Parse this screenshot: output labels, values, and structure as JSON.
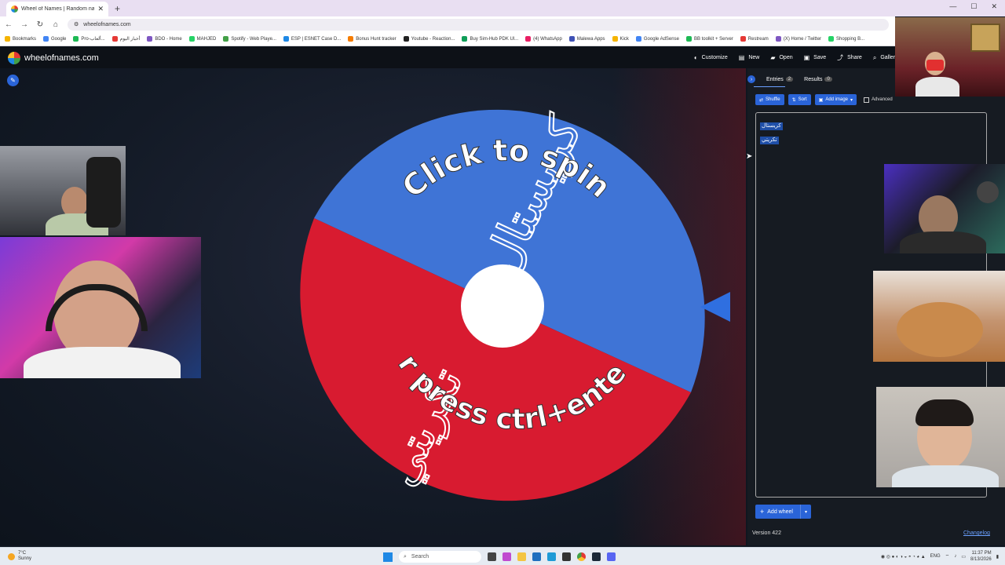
{
  "browser": {
    "tab_title": "Wheel of Names | Random nam",
    "url": "wheelofnames.com",
    "bookmarks": [
      "Bookmarks",
      "Google",
      "Pro-ألعاب...",
      "أخبار اليوم",
      "BDO - Home",
      "MAHJED",
      "Spotify - Web Playe...",
      "ESP | ESNET Case D...",
      "Bonus Hunt tracker",
      "Youtube - Reaction...",
      "Buy Sim-Hub PDK Ul...",
      "(4) WhatsApp",
      "Malewa Apps",
      "Kick",
      "Google AdSense",
      "BB toolkit + Server",
      "Restream",
      "(X) Home / Twitter",
      "Shopping B..."
    ]
  },
  "header": {
    "brand": "wheelofnames.com",
    "buttons": [
      {
        "label": "Customize",
        "icon": "palette-icon"
      },
      {
        "label": "New",
        "icon": "file-icon"
      },
      {
        "label": "Open",
        "icon": "folder-icon"
      },
      {
        "label": "Save",
        "icon": "save-icon"
      },
      {
        "label": "Share",
        "icon": "share-icon"
      },
      {
        "label": "Galler",
        "icon": "search-icon"
      }
    ]
  },
  "wheel": {
    "click_text": "Click to spin",
    "press_text": "or press ctrl+enter",
    "segments": [
      {
        "label": "كريستال",
        "color": "#3f74d6"
      },
      {
        "label": "تكريتي",
        "color": "#d81b30"
      }
    ],
    "pointer_color": "#2f6fe0"
  },
  "panel": {
    "tabs": [
      {
        "label": "Entries",
        "count": "2"
      },
      {
        "label": "Results",
        "count": "0"
      }
    ],
    "buttons": {
      "shuffle": "Shuffle",
      "sort": "Sort",
      "add_image": "Add image",
      "advanced": "Advanced"
    },
    "entries": [
      "كريستال",
      "تكريتي"
    ],
    "add_wheel": "Add wheel",
    "version": "Version 422",
    "changelog": "Changelog"
  },
  "taskbar": {
    "temp": "7°C",
    "weather": "Sunny",
    "search": "Search",
    "lang": "ENG",
    "time": "11:37 PM",
    "date": "8/13/2026"
  }
}
